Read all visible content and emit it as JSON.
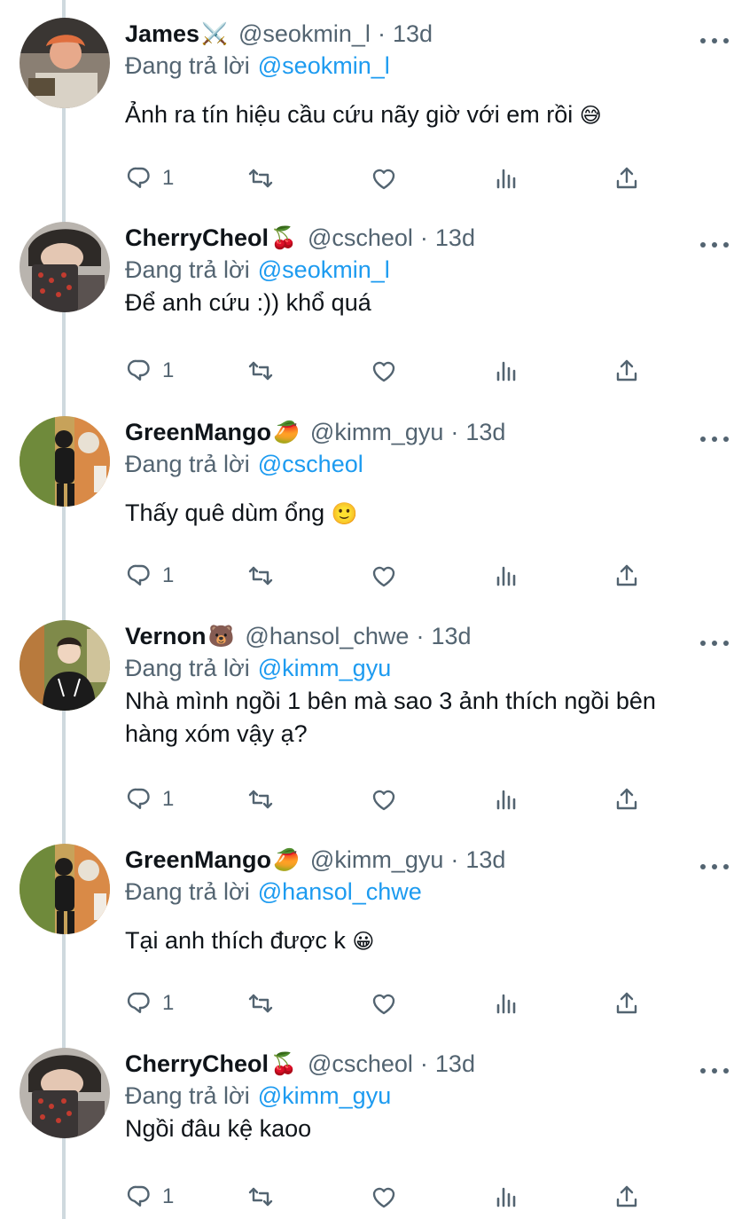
{
  "reply_prefix": "Đang trả lời",
  "tweets": [
    {
      "name": "James",
      "badge": "⚔️",
      "handle": "@seokmin_l",
      "time": "13d",
      "replying_to": "@seokmin_l",
      "text": "Ảnh ra tín hiệu cầu cứu nãy giờ với em rồi",
      "emoji": "😅",
      "reply_count": "1"
    },
    {
      "name": "CherryCheol",
      "badge": "🍒",
      "handle": "@cscheol",
      "time": "13d",
      "replying_to": "@seokmin_l",
      "text": "Để anh cứu :)) khổ quá",
      "emoji": "",
      "reply_count": "1"
    },
    {
      "name": "GreenMango",
      "badge": "🥭",
      "handle": "@kimm_gyu",
      "time": "13d",
      "replying_to": "@cscheol",
      "text": "Thấy quê dùm ổng",
      "emoji": "🙂",
      "reply_count": "1"
    },
    {
      "name": "Vernon",
      "badge": "🐻",
      "handle": "@hansol_chwe",
      "time": "13d",
      "replying_to": "@kimm_gyu",
      "text_line1": "Nhà mình ngồi 1 bên mà sao 3 ảnh thích ngồi bên",
      "text_line2": "hàng xóm vậy ạ?",
      "reply_count": "1"
    },
    {
      "name": "GreenMango",
      "badge": "🥭",
      "handle": "@kimm_gyu",
      "time": "13d",
      "replying_to": "@hansol_chwe",
      "text": "Tại anh thích được k",
      "emoji": "😀",
      "reply_count": "1"
    },
    {
      "name": "CherryCheol",
      "badge": "🍒",
      "handle": "@cscheol",
      "time": "13d",
      "replying_to": "@kimm_gyu",
      "text": "Ngồi đâu kệ kaoo",
      "emoji": "",
      "reply_count": "1"
    }
  ],
  "colors": {
    "text": "#0f1419",
    "secondary": "#536471",
    "link": "#1d9bf0",
    "thread_line": "#cfd9de"
  }
}
